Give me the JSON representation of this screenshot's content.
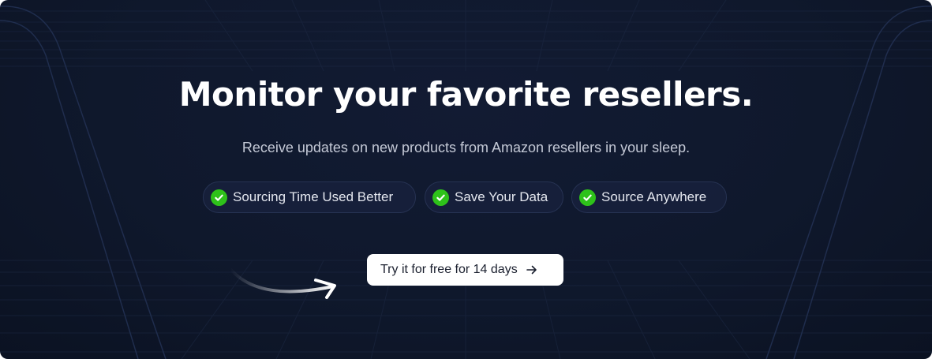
{
  "hero": {
    "headline": "Monitor your favorite resellers.",
    "subtitle": "Receive updates on new products from Amazon resellers in your sleep.",
    "features": [
      {
        "label": "Sourcing Time Used Better",
        "icon": "check-circle-icon"
      },
      {
        "label": "Save Your Data",
        "icon": "check-circle-icon"
      },
      {
        "label": "Source Anywhere",
        "icon": "check-circle-icon"
      }
    ],
    "cta": {
      "label": "Try it for free for 14 days",
      "icon": "arrow-right-icon"
    }
  },
  "colors": {
    "background": "#0f182c",
    "check_green": "#2ec21a",
    "cta_background": "#ffffff",
    "headline": "#ffffff",
    "subtitle": "#c4c9d6"
  }
}
